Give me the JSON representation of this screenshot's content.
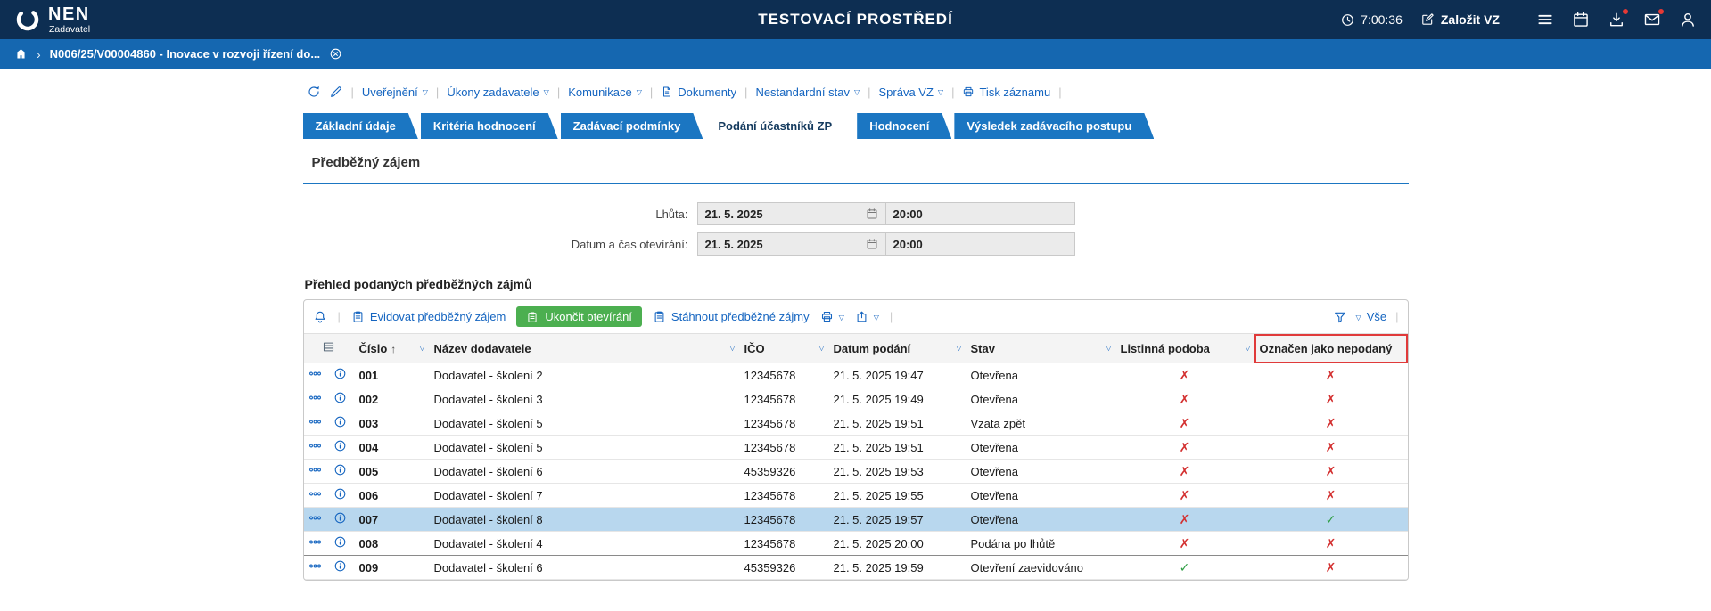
{
  "colors": {
    "navy": "#0d2e52",
    "bar_blue": "#1567b0",
    "tab_blue": "#1b76c2",
    "link_blue": "#1565c0",
    "action_green": "#4caf50",
    "cross_red": "#d32f2f",
    "check_green": "#2f9e44",
    "selected_row": "#b8d7ee",
    "header_bg": "#f4f4f4",
    "highlight_red": "#e03a3a"
  },
  "topbar": {
    "brand": "NEN",
    "brand_sub": "Zadavatel",
    "title": "TESTOVACÍ PROSTŘEDÍ",
    "time": "7:00:36",
    "create_vz": "Založit VZ"
  },
  "breadcrumb": {
    "current": "N006/25/V00004860 - Inovace v rozvoji řízení do..."
  },
  "record_toolbar": {
    "items": [
      {
        "label": "Uveřejnění",
        "caret": true
      },
      {
        "label": "Úkony zadavatele",
        "caret": true
      },
      {
        "label": "Komunikace",
        "caret": true
      },
      {
        "label": "Dokumenty",
        "caret": false,
        "icon": "document"
      },
      {
        "label": "Nestandardní stav",
        "caret": true
      },
      {
        "label": "Správa VZ",
        "caret": true
      },
      {
        "label": "Tisk záznamu",
        "caret": false,
        "icon": "printer"
      }
    ]
  },
  "tabs": [
    {
      "label": "Základní údaje",
      "active": false
    },
    {
      "label": "Kritéria hodnocení",
      "active": false
    },
    {
      "label": "Zadávací podmínky",
      "active": false
    },
    {
      "label": "Podání účastníků ZP",
      "active": true
    },
    {
      "label": "Hodnocení",
      "active": false
    },
    {
      "label": "Výsledek zadávacího postupu",
      "active": false
    }
  ],
  "section_title": "Předběžný zájem",
  "form": {
    "rows": [
      {
        "label": "Lhůta:",
        "date": "21. 5. 2025",
        "time": "20:00"
      },
      {
        "label": "Datum a čas otevírání:",
        "date": "21. 5. 2025",
        "time": "20:00"
      }
    ]
  },
  "list": {
    "title": "Přehled podaných předběžných zájmů",
    "actions": {
      "register": "Evidovat předběžný zájem",
      "finish": "Ukončit otevírání",
      "download": "Stáhnout předběžné zájmy",
      "all": "Vše"
    },
    "columns": [
      {
        "label": "Číslo",
        "sort": "asc",
        "caret": true
      },
      {
        "label": "Název dodavatele",
        "caret": true
      },
      {
        "label": "IČO",
        "caret": true
      },
      {
        "label": "Datum podání",
        "caret": true
      },
      {
        "label": "Stav",
        "caret": true
      },
      {
        "label": "Listinná podoba",
        "caret": true
      },
      {
        "label": "Označen jako nepodaný",
        "caret": false,
        "highlighted": true
      }
    ],
    "rows": [
      {
        "num": "001",
        "supplier": "Dodavatel - školení 2",
        "ico": "12345678",
        "submitted": "21. 5. 2025 19:47",
        "status": "Otevřena",
        "paper": false,
        "unsubmitted": false
      },
      {
        "num": "002",
        "supplier": "Dodavatel - školení 3",
        "ico": "12345678",
        "submitted": "21. 5. 2025 19:49",
        "status": "Otevřena",
        "paper": false,
        "unsubmitted": false
      },
      {
        "num": "003",
        "supplier": "Dodavatel - školení 5",
        "ico": "12345678",
        "submitted": "21. 5. 2025 19:51",
        "status": "Vzata zpět",
        "paper": false,
        "unsubmitted": false
      },
      {
        "num": "004",
        "supplier": "Dodavatel - školení 5",
        "ico": "12345678",
        "submitted": "21. 5. 2025 19:51",
        "status": "Otevřena",
        "paper": false,
        "unsubmitted": false
      },
      {
        "num": "005",
        "supplier": "Dodavatel - školení 6",
        "ico": "45359326",
        "submitted": "21. 5. 2025 19:53",
        "status": "Otevřena",
        "paper": false,
        "unsubmitted": false
      },
      {
        "num": "006",
        "supplier": "Dodavatel - školení 7",
        "ico": "12345678",
        "submitted": "21. 5. 2025 19:55",
        "status": "Otevřena",
        "paper": false,
        "unsubmitted": false
      },
      {
        "num": "007",
        "supplier": "Dodavatel - školení 8",
        "ico": "12345678",
        "submitted": "21. 5. 2025 19:57",
        "status": "Otevřena",
        "paper": false,
        "unsubmitted": true,
        "selected": true
      },
      {
        "num": "008",
        "supplier": "Dodavatel - školení 4",
        "ico": "12345678",
        "submitted": "21. 5. 2025 20:00",
        "status": "Podána po lhůtě",
        "paper": false,
        "unsubmitted": false,
        "divider": true
      },
      {
        "num": "009",
        "supplier": "Dodavatel - školení 6",
        "ico": "45359326",
        "submitted": "21. 5. 2025 19:59",
        "status": "Otevření zaevidováno",
        "paper": true,
        "unsubmitted": false
      }
    ]
  }
}
